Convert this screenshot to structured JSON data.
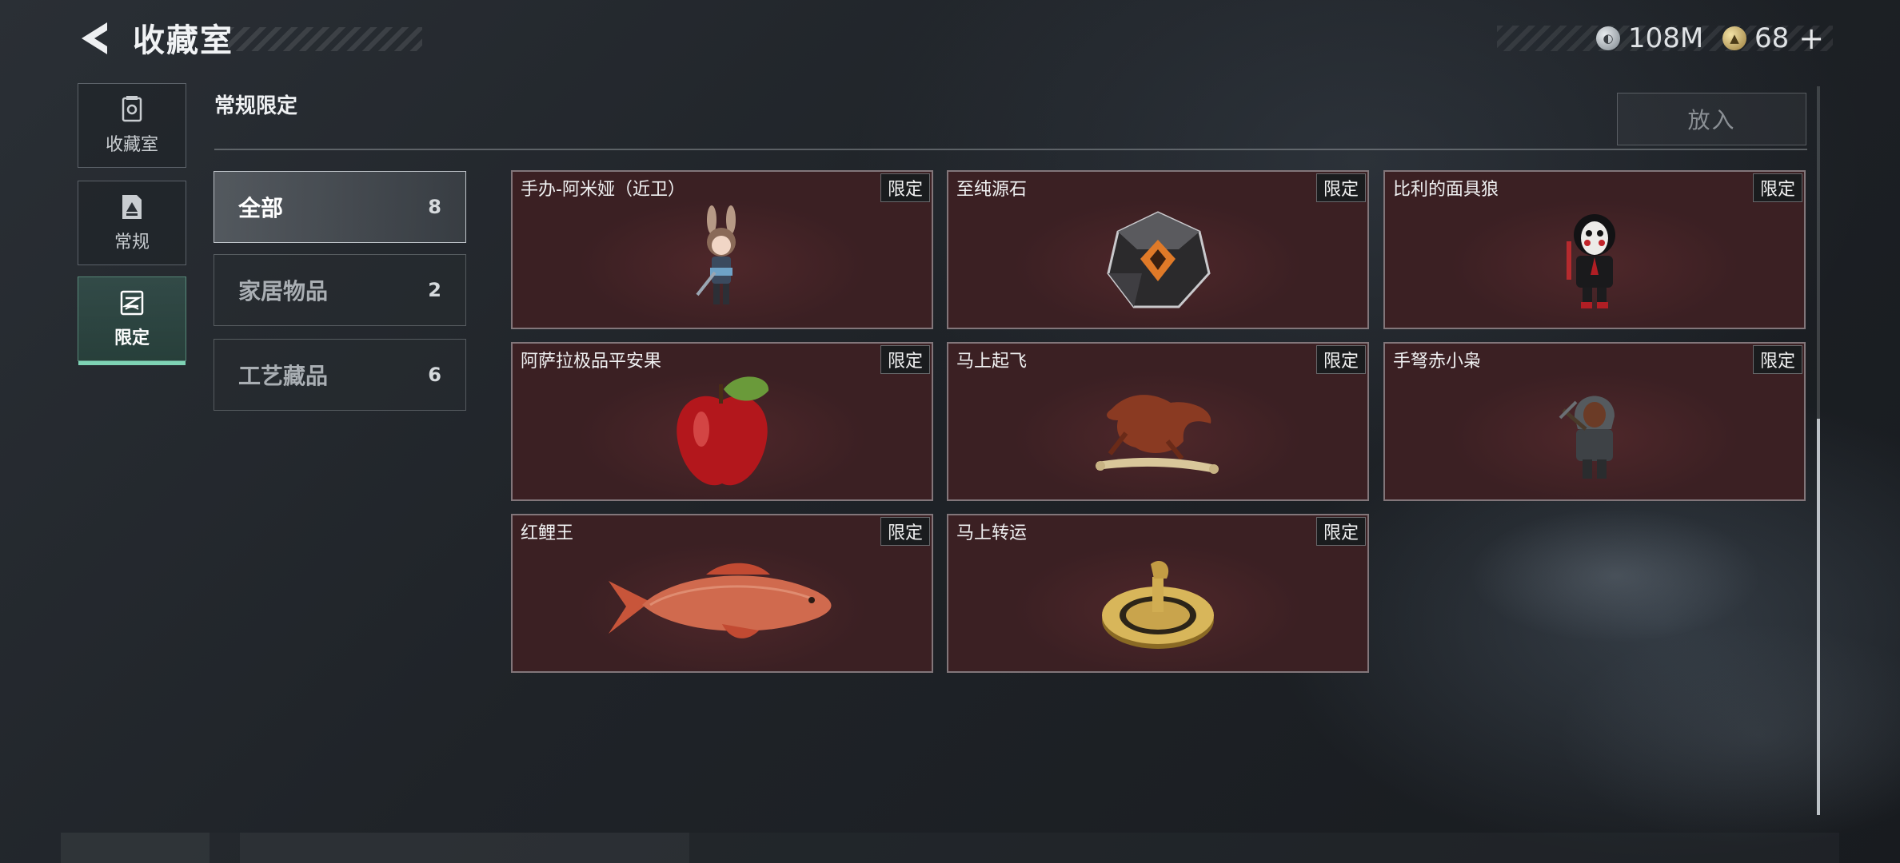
{
  "header": {
    "title": "收藏室",
    "currencies": [
      {
        "icon": "silver-coin-icon",
        "value": "108M"
      },
      {
        "icon": "gold-coin-icon",
        "value": "68"
      }
    ],
    "plus": "+"
  },
  "nav": [
    {
      "label": "收藏室",
      "icon": "vault-icon",
      "active": false
    },
    {
      "label": "常规",
      "icon": "regular-card-icon",
      "active": false
    },
    {
      "label": "限定",
      "icon": "limited-card-icon",
      "active": true
    }
  ],
  "section": {
    "title": "常规限定",
    "put_button": "放入"
  },
  "categories": [
    {
      "label": "全部",
      "count": "8",
      "active": true
    },
    {
      "label": "家居物品",
      "count": "2",
      "active": false
    },
    {
      "label": "工艺藏品",
      "count": "6",
      "active": false
    }
  ],
  "items": [
    {
      "name": "手办-阿米娅（近卫）",
      "tag": "限定",
      "art": "figure-amiya-icon"
    },
    {
      "name": "至纯源石",
      "tag": "限定",
      "art": "originium-crystal-icon"
    },
    {
      "name": "比利的面具狼",
      "tag": "限定",
      "art": "billy-mask-figure-icon"
    },
    {
      "name": "阿萨拉极品平安果",
      "tag": "限定",
      "art": "red-apple-icon"
    },
    {
      "name": "马上起飞",
      "tag": "限定",
      "art": "bronze-horse-icon"
    },
    {
      "name": "手弩赤小枭",
      "tag": "限定",
      "art": "crossbow-figure-icon"
    },
    {
      "name": "红鲤王",
      "tag": "限定",
      "art": "red-carp-icon"
    },
    {
      "name": "马上转运",
      "tag": "限定",
      "art": "golden-coin-horse-icon"
    }
  ],
  "colors": {
    "accent": "#7fd3b5",
    "card_bg": "#3b2023",
    "background": "#1f2328"
  }
}
